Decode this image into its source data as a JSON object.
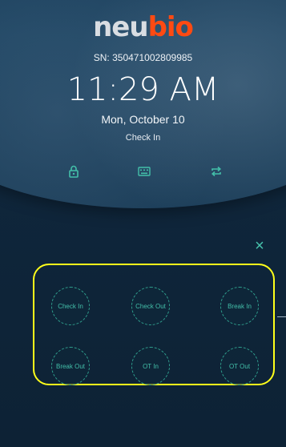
{
  "header": {
    "logo_part1": "neu",
    "logo_part2": "bio",
    "serial": "SN: 350471002809985",
    "time": "11:29 AM",
    "date": "Mon, October 10",
    "mode": "Check In"
  },
  "icons": {
    "lock": "lock-icon",
    "keyboard": "keyboard-icon",
    "swap": "swap-icon",
    "close": "close-icon"
  },
  "close_label": "×",
  "actions": [
    {
      "label": "Check In"
    },
    {
      "label": "Check Out"
    },
    {
      "label": "Break In"
    },
    {
      "label": "Break Out"
    },
    {
      "label": "OT In"
    },
    {
      "label": "OT Out"
    }
  ],
  "colors": {
    "accent": "#43bfa9",
    "brand_orange": "#ff4a12",
    "highlight": "#ffff1a",
    "background": "#0f2438"
  }
}
